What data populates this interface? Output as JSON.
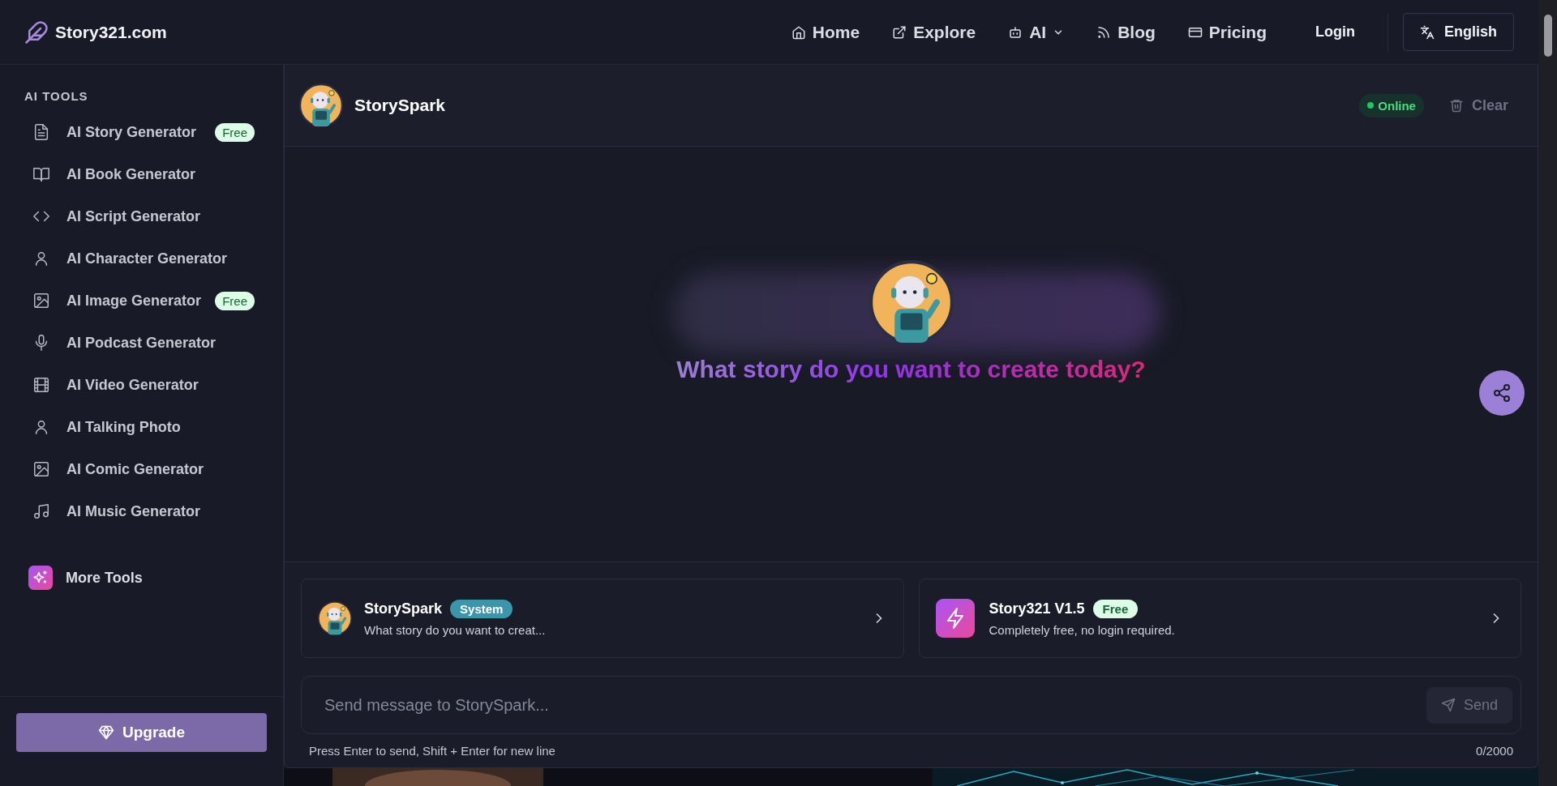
{
  "header": {
    "logo_text": "Story321.com",
    "nav": [
      {
        "label": "Home",
        "dropdown": false
      },
      {
        "label": "Explore",
        "dropdown": false
      },
      {
        "label": "AI",
        "dropdown": true
      },
      {
        "label": "Blog",
        "dropdown": false
      },
      {
        "label": "Pricing",
        "dropdown": false
      }
    ],
    "login": "Login",
    "language": "English"
  },
  "sidebar": {
    "section_title": "AI TOOLS",
    "items": [
      {
        "label": "AI Story Generator",
        "badge": "Free"
      },
      {
        "label": "AI Book Generator"
      },
      {
        "label": "AI Script Generator"
      },
      {
        "label": "AI Character Generator"
      },
      {
        "label": "AI Image Generator",
        "badge": "Free"
      },
      {
        "label": "AI Podcast Generator"
      },
      {
        "label": "AI Video Generator"
      },
      {
        "label": "AI Talking Photo"
      },
      {
        "label": "AI Comic Generator"
      },
      {
        "label": "AI Music Generator"
      }
    ],
    "more_tools": "More Tools",
    "upgrade": "Upgrade"
  },
  "chat": {
    "bot_name": "StorySpark",
    "status": "Online",
    "clear": "Clear",
    "prompt": "What story do you want to create today?",
    "cards": [
      {
        "kind": "bot",
        "title": "StorySpark",
        "badge": "System",
        "subtitle": "What story do you want to creat..."
      },
      {
        "kind": "model",
        "title": "Story321 V1.5",
        "badge": "Free",
        "subtitle": "Completely free, no login required."
      }
    ],
    "input": {
      "placeholder": "Send message to StorySpark...",
      "send": "Send",
      "hint": "Press Enter to send, Shift + Enter for new line",
      "counter": "0/2000"
    }
  }
}
